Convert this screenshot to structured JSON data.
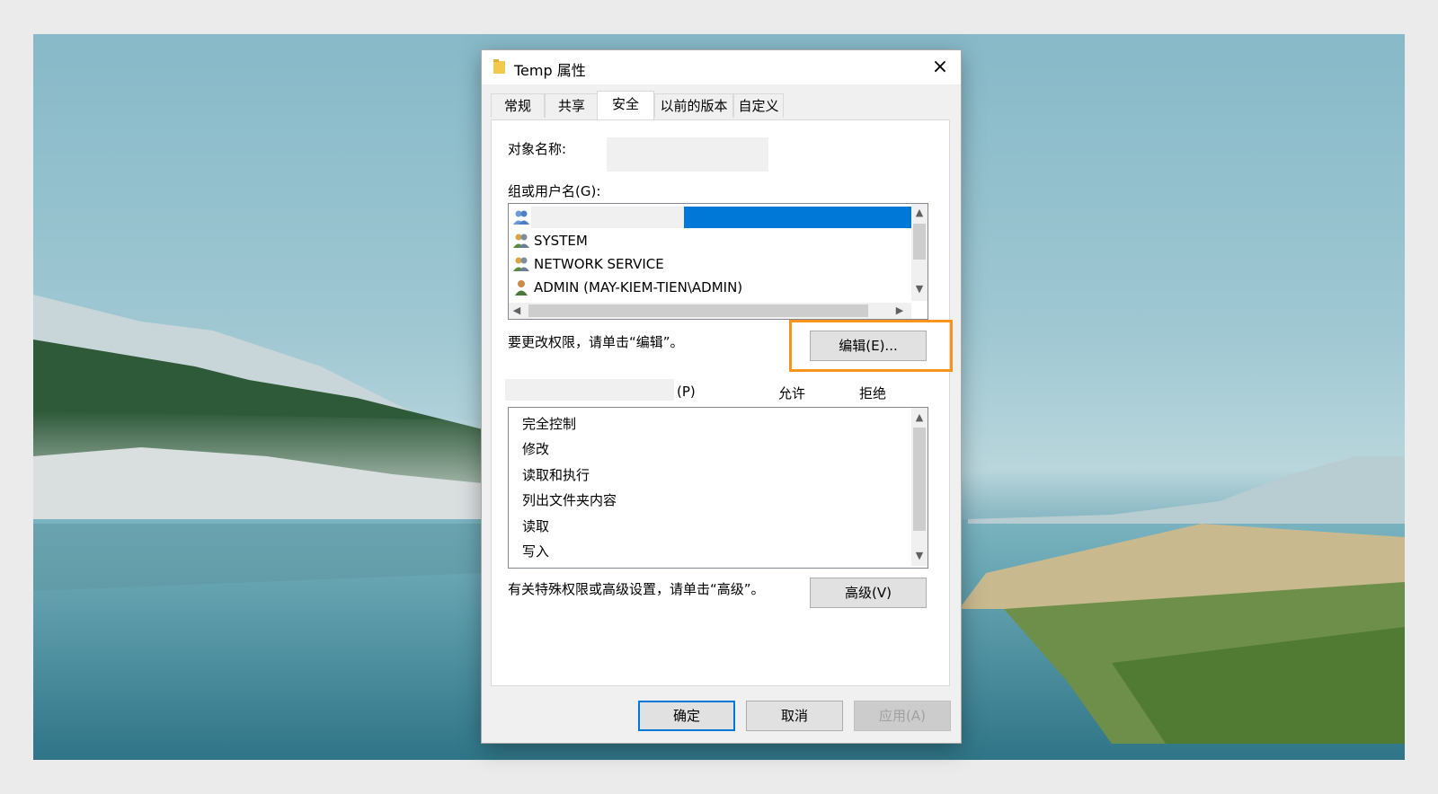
{
  "dialog": {
    "title": "Temp 属性",
    "close_icon": "×"
  },
  "tabs": [
    {
      "label": "常规"
    },
    {
      "label": "共享"
    },
    {
      "label": "安全"
    },
    {
      "label": "以前的版本"
    },
    {
      "label": "自定义"
    }
  ],
  "security": {
    "object_name_label": "对象名称:",
    "object_name_value": "",
    "groups_label": "组或用户名(G):",
    "users": [
      {
        "name": "",
        "icon": "user-group-icon"
      },
      {
        "name": "SYSTEM",
        "icon": "user-group-icon"
      },
      {
        "name": "NETWORK SERVICE",
        "icon": "user-group-icon"
      },
      {
        "name": "ADMIN (MAY-KIEM-TIEN\\ADMIN)",
        "icon": "user-icon"
      }
    ],
    "edit_hint": "要更改权限，请单击“编辑”。",
    "edit_button": "编辑(E)...",
    "permissions_header_suffix": "(P)",
    "allow_header": "允许",
    "deny_header": "拒绝",
    "permissions": [
      "完全控制",
      "修改",
      "读取和执行",
      "列出文件夹内容",
      "读取",
      "写入"
    ],
    "advanced_hint": "有关特殊权限或高级设置，请单击“高级”。",
    "advanced_button": "高级(V)"
  },
  "footer": {
    "ok_button": "确定",
    "cancel_button": "取消",
    "apply_button": "应用(A)"
  },
  "colors": {
    "selection": "#0078d7",
    "highlight": "#f7941d"
  }
}
